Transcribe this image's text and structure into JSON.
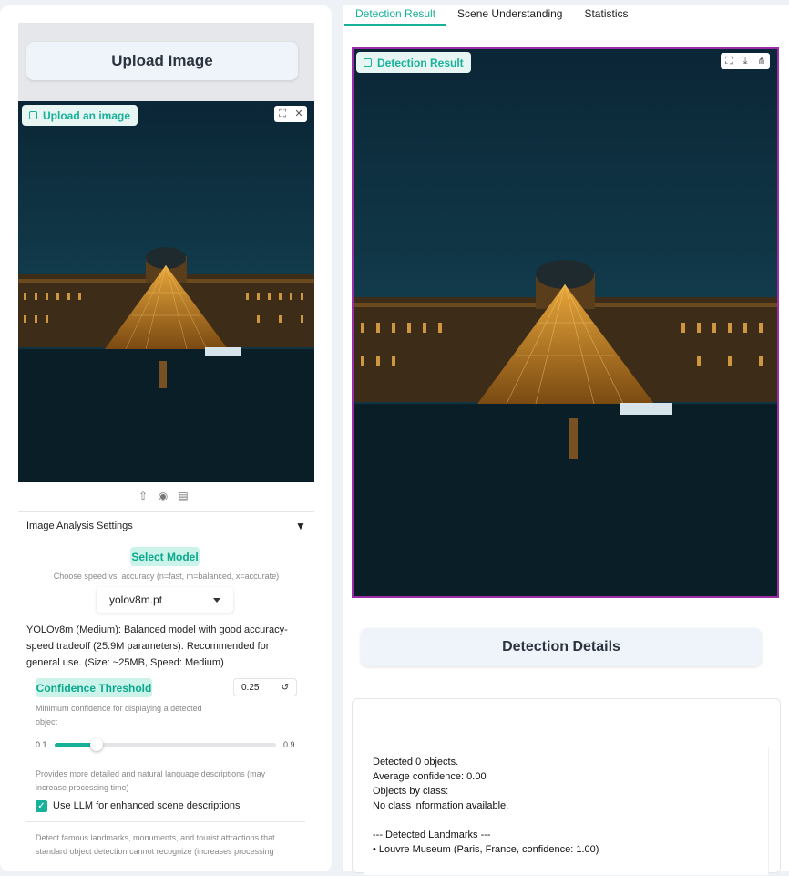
{
  "left_panel": {
    "upload_button_label": "Upload Image",
    "upload_chip_label": "Upload an image",
    "image_tool_icons": [
      "expand-icon",
      "close-icon"
    ],
    "source_tool_icons": [
      "upload-icon",
      "webcam-icon",
      "clipboard-icon"
    ]
  },
  "settings": {
    "title": "Image Analysis Settings",
    "collapse_glyph": "▼",
    "select_model_label": "Select Model",
    "select_model_hint": "Choose speed vs. accuracy (n=fast, m=balanced, x=accurate)",
    "model_value": "yolov8m.pt",
    "model_description": "YOLOv8m (Medium): Balanced model with good accuracy-speed tradeoff (25.9M parameters). Recommended for general use. (Size: ~25MB, Speed: Medium)",
    "confidence_label": "Confidence Threshold",
    "confidence_value": "0.25",
    "confidence_reset_glyph": "↺",
    "confidence_hint": "Minimum confidence for displaying a detected object",
    "slider_min": "0.1",
    "slider_max": "0.9",
    "slider_fraction": 0.1875,
    "llm_hint": "Provides more detailed and natural language descriptions (may increase processing time)",
    "llm_checkbox_label": "Use LLM for enhanced scene descriptions",
    "llm_checked": true,
    "landmark_hint": "Detect famous landmarks, monuments, and tourist attractions that standard object detection cannot recognize (increases processing"
  },
  "right_panel": {
    "tabs": [
      "Detection Result",
      "Scene Understanding",
      "Statistics"
    ],
    "active_tab": 0,
    "result_chip_label": "Detection Result",
    "result_tool_icons": [
      "expand-icon",
      "download-icon",
      "share-icon"
    ],
    "details_button_label": "Detection Details",
    "details_lines": [
      "Detected 0 objects.",
      "Average confidence: 0.00",
      "Objects by class:",
      "No class information available.",
      "",
      "--- Detected Landmarks ---",
      "• Louvre Museum (Paris, France, confidence: 1.00)"
    ]
  },
  "colors": {
    "accent": "#17b19a",
    "frame_border": "#9b2ea8",
    "sky": "#0e3442",
    "light": "#f5a623"
  }
}
